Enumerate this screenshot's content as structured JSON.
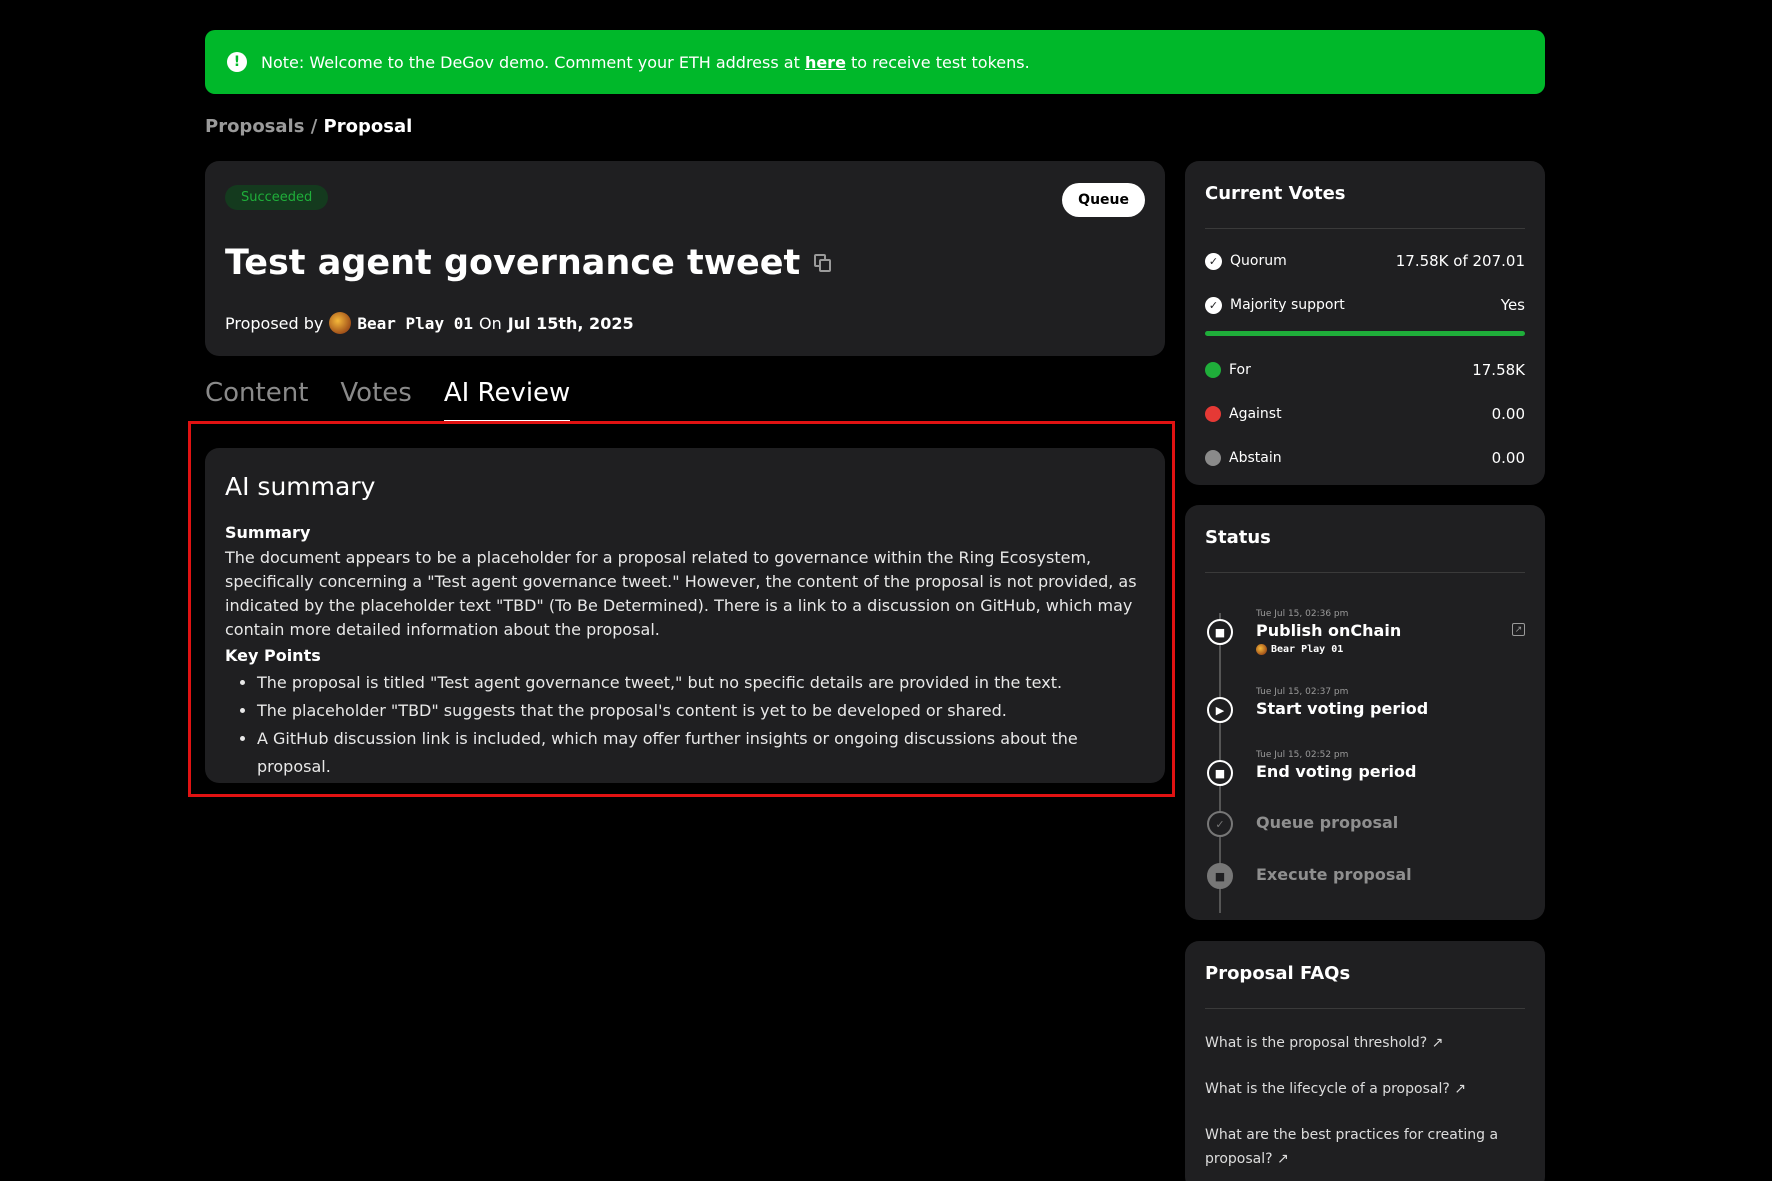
{
  "banner": {
    "prefix": "Note: Welcome to the DeGov demo. Comment your ETH address at ",
    "link": "here",
    "suffix": " to receive test tokens."
  },
  "breadcrumb": {
    "parent": "Proposals",
    "separator": " / ",
    "current": "Proposal"
  },
  "proposal": {
    "status": "Succeeded",
    "queue_label": "Queue",
    "title": "Test agent governance tweet",
    "proposed_by_label": "Proposed by",
    "proposer": "Bear Play 01",
    "on_label": "On",
    "date": "Jul 15th, 2025"
  },
  "tabs": [
    "Content",
    "Votes",
    "AI Review"
  ],
  "ai": {
    "heading": "AI summary",
    "summary_heading": "Summary",
    "summary": "The document appears to be a placeholder for a proposal related to governance within the Ring Ecosystem, specifically concerning a \"Test agent governance tweet.\" However, the content of the proposal is not provided, as indicated by the placeholder text \"TBD\" (To Be Determined). There is a link to a discussion on GitHub, which may contain more detailed information about the proposal.",
    "key_points_heading": "Key Points",
    "key_points": [
      "The proposal is titled \"Test agent governance tweet,\" but no specific details are provided in the text.",
      "The placeholder \"TBD\" suggests that the proposal's content is yet to be developed or shared.",
      "A GitHub discussion link is included, which may offer further insights or ongoing discussions about the proposal."
    ]
  },
  "votes": {
    "title": "Current Votes",
    "quorum_label": "Quorum",
    "quorum_value": "17.58K of 207.01",
    "majority_label": "Majority support",
    "majority_value": "Yes",
    "support_fraction": 1.0,
    "for_label": "For",
    "for_value": "17.58K",
    "against_label": "Against",
    "against_value": "0.00",
    "abstain_label": "Abstain",
    "abstain_value": "0.00",
    "colors": {
      "for": "#1fae3a",
      "against": "#e53935",
      "abstain": "#8a8a8a"
    }
  },
  "status": {
    "title": "Status",
    "steps": [
      {
        "time": "Tue Jul 15, 02:36 pm",
        "label": "Publish onChain",
        "by": "Bear Play 01"
      },
      {
        "time": "Tue Jul 15, 02:37 pm",
        "label": "Start voting period"
      },
      {
        "time": "Tue Jul 15, 02:52 pm",
        "label": "End voting period"
      },
      {
        "label": "Queue proposal"
      },
      {
        "label": "Execute proposal"
      }
    ]
  },
  "faq": {
    "title": "Proposal FAQs",
    "items": [
      "What is the proposal threshold? ↗",
      "What is the lifecycle of a proposal? ↗",
      "What are the best practices for creating a proposal? ↗"
    ]
  }
}
